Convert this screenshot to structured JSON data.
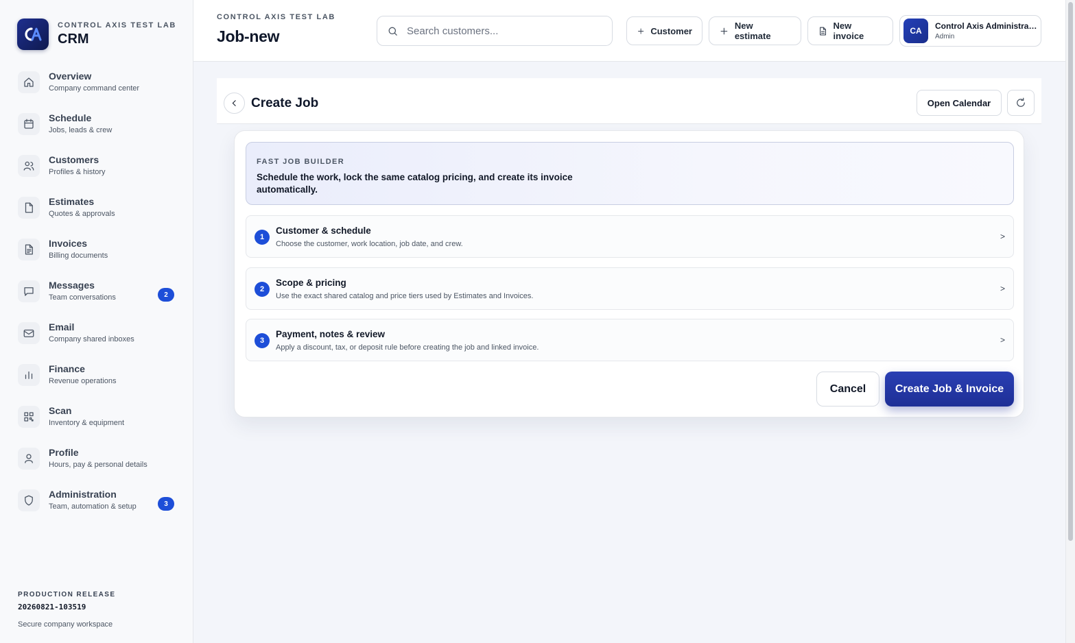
{
  "brand": {
    "subtitle": "CONTROL AXIS TEST LAB",
    "title": "CRM",
    "logo_text": "CA"
  },
  "sidebar": {
    "items": [
      {
        "label": "Overview",
        "desc": "Company command center",
        "icon": "home-icon"
      },
      {
        "label": "Schedule",
        "desc": "Jobs, leads & crew",
        "icon": "calendar-icon"
      },
      {
        "label": "Customers",
        "desc": "Profiles & history",
        "icon": "users-icon"
      },
      {
        "label": "Estimates",
        "desc": "Quotes & approvals",
        "icon": "file-icon"
      },
      {
        "label": "Invoices",
        "desc": "Billing documents",
        "icon": "invoice-icon"
      },
      {
        "label": "Messages",
        "desc": "Team conversations",
        "icon": "message-icon",
        "badge": "2"
      },
      {
        "label": "Email",
        "desc": "Company shared inboxes",
        "icon": "mail-icon"
      },
      {
        "label": "Finance",
        "desc": "Revenue operations",
        "icon": "bar-chart-icon"
      },
      {
        "label": "Scan",
        "desc": "Inventory & equipment",
        "icon": "qr-icon"
      },
      {
        "label": "Profile",
        "desc": "Hours, pay & personal details",
        "icon": "user-icon"
      },
      {
        "label": "Administration",
        "desc": "Team, automation & setup",
        "icon": "shield-icon",
        "badge": "3"
      }
    ],
    "release": {
      "label": "PRODUCTION RELEASE",
      "version": "20260821-103519",
      "note": "Secure company workspace"
    }
  },
  "header": {
    "subtitle": "CONTROL AXIS TEST LAB",
    "title": "Job-new",
    "search_placeholder": "Search customers...",
    "buttons": {
      "customer": "Customer",
      "estimate": "New estimate",
      "invoice": "New invoice"
    },
    "user": {
      "initials": "CA",
      "name": "Control Axis Administrator",
      "role": "Admin"
    }
  },
  "page": {
    "title": "Create Job",
    "open_calendar": "Open Calendar",
    "intro": {
      "label": "FAST JOB BUILDER",
      "text": "Schedule the work, lock the same catalog pricing, and create its invoice automatically."
    },
    "steps": [
      {
        "num": "1",
        "title": "Customer & schedule",
        "desc": "Choose the customer, work location, job date, and crew."
      },
      {
        "num": "2",
        "title": "Scope & pricing",
        "desc": "Use the exact shared catalog and price tiers used by Estimates and Invoices."
      },
      {
        "num": "3",
        "title": "Payment, notes & review",
        "desc": "Apply a discount, tax, or deposit rule before creating the job and linked invoice."
      }
    ],
    "cancel": "Cancel",
    "create": "Create Job & Invoice"
  },
  "colors": {
    "accent": "#1d4ed8",
    "primary_button": "#1e2f96",
    "brand_dark": "#0f1a4f"
  }
}
